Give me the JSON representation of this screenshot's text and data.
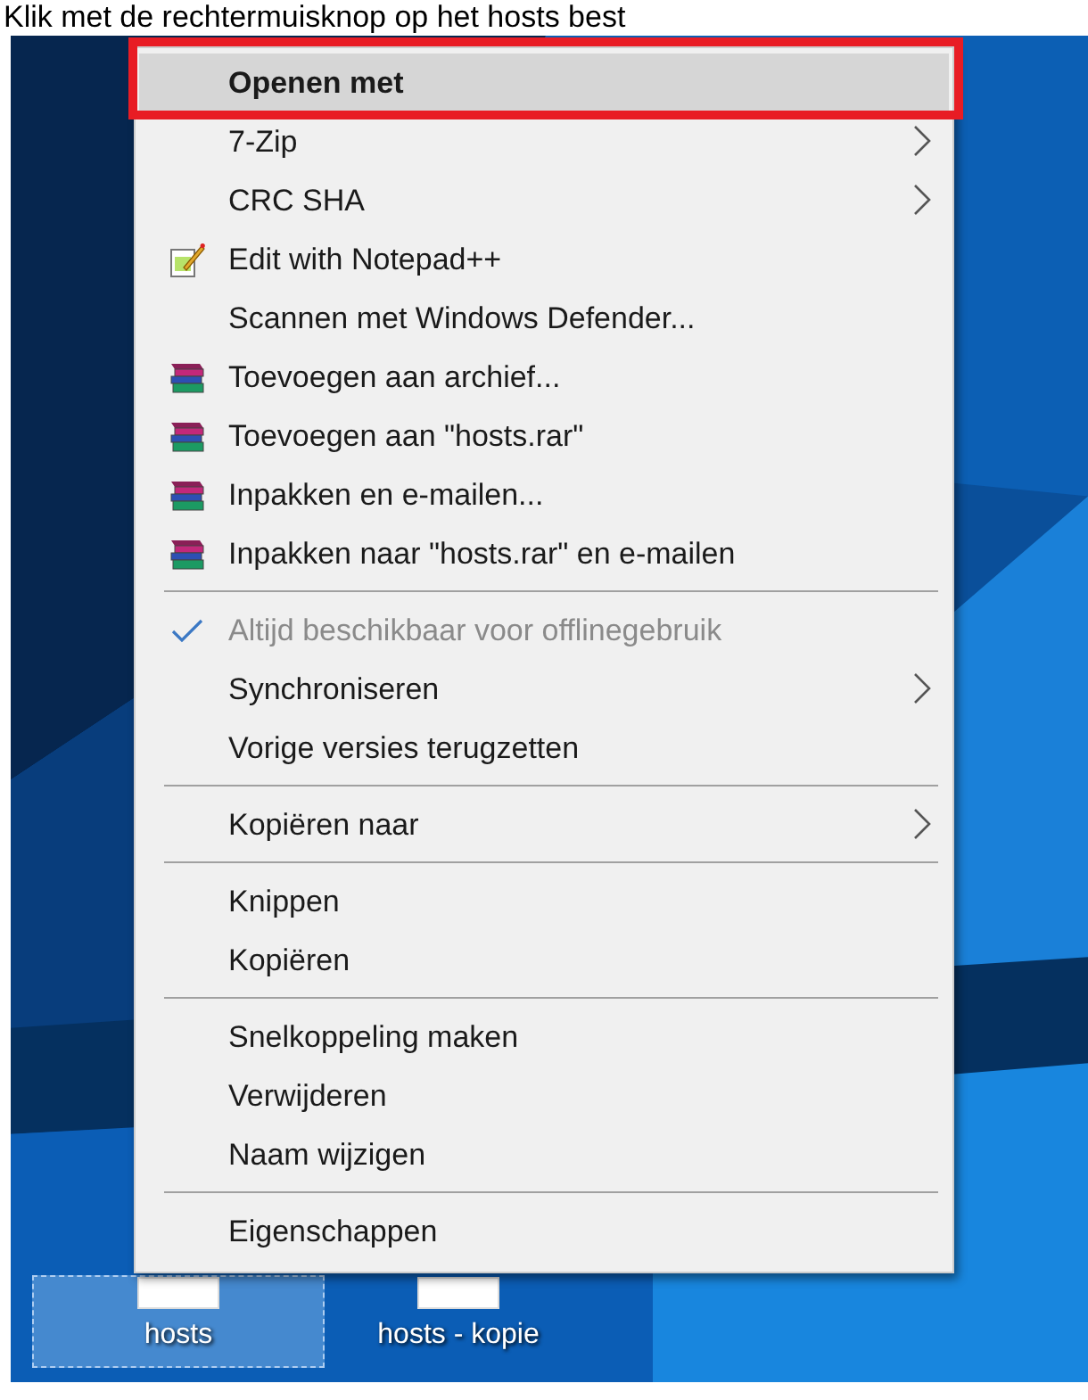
{
  "caption": "Klik met de rechtermuisknop op het hosts best",
  "context_menu": {
    "items": [
      {
        "kind": "item",
        "label": "Openen met",
        "bold": true,
        "selected": true,
        "checked": false,
        "disabled": false,
        "submenu": false
      },
      {
        "kind": "item",
        "label": "7-Zip",
        "bold": false,
        "selected": false,
        "checked": false,
        "disabled": false,
        "submenu": true
      },
      {
        "kind": "item",
        "label": "CRC SHA",
        "bold": false,
        "selected": false,
        "checked": false,
        "disabled": false,
        "submenu": true
      },
      {
        "kind": "notepad-item",
        "label": "Edit with Notepad++",
        "bold": false,
        "selected": false,
        "checked": false,
        "disabled": false,
        "submenu": false
      },
      {
        "kind": "item",
        "label": "Scannen met Windows Defender...",
        "bold": false,
        "selected": false,
        "checked": false,
        "disabled": false,
        "submenu": false
      },
      {
        "kind": "archive-item",
        "label": "Toevoegen aan archief...",
        "bold": false,
        "selected": false,
        "checked": false,
        "disabled": false,
        "submenu": false
      },
      {
        "kind": "archive-item",
        "label": "Toevoegen aan \"hosts.rar\"",
        "bold": false,
        "selected": false,
        "checked": false,
        "disabled": false,
        "submenu": false
      },
      {
        "kind": "archive-item",
        "label": "Inpakken en e-mailen...",
        "bold": false,
        "selected": false,
        "checked": false,
        "disabled": false,
        "submenu": false
      },
      {
        "kind": "archive-item",
        "label": "Inpakken naar \"hosts.rar\" en e-mailen",
        "bold": false,
        "selected": false,
        "checked": false,
        "disabled": false,
        "submenu": false
      },
      {
        "kind": "separator"
      },
      {
        "kind": "item",
        "label": "Altijd beschikbaar voor offlinegebruik",
        "bold": false,
        "selected": false,
        "checked": true,
        "disabled": true,
        "submenu": false
      },
      {
        "kind": "item",
        "label": "Synchroniseren",
        "bold": false,
        "selected": false,
        "checked": false,
        "disabled": false,
        "submenu": true
      },
      {
        "kind": "item",
        "label": "Vorige versies terugzetten",
        "bold": false,
        "selected": false,
        "checked": false,
        "disabled": false,
        "submenu": false
      },
      {
        "kind": "separator"
      },
      {
        "kind": "item",
        "label": "Kopiëren naar",
        "bold": false,
        "selected": false,
        "checked": false,
        "disabled": false,
        "submenu": true
      },
      {
        "kind": "separator"
      },
      {
        "kind": "item",
        "label": "Knippen",
        "bold": false,
        "selected": false,
        "checked": false,
        "disabled": false,
        "submenu": false
      },
      {
        "kind": "item",
        "label": "Kopiëren",
        "bold": false,
        "selected": false,
        "checked": false,
        "disabled": false,
        "submenu": false
      },
      {
        "kind": "separator"
      },
      {
        "kind": "item",
        "label": "Snelkoppeling maken",
        "bold": false,
        "selected": false,
        "checked": false,
        "disabled": false,
        "submenu": false
      },
      {
        "kind": "item",
        "label": "Verwijderen",
        "bold": false,
        "selected": false,
        "checked": false,
        "disabled": false,
        "submenu": false
      },
      {
        "kind": "item",
        "label": "Naam wijzigen",
        "bold": false,
        "selected": false,
        "checked": false,
        "disabled": false,
        "submenu": false
      },
      {
        "kind": "separator"
      },
      {
        "kind": "item",
        "label": "Eigenschappen",
        "bold": false,
        "selected": false,
        "checked": false,
        "disabled": false,
        "submenu": false
      }
    ]
  },
  "desktop_icons": [
    {
      "label": "hosts",
      "selected": true
    },
    {
      "label": "hosts - kopie",
      "selected": false
    }
  ]
}
